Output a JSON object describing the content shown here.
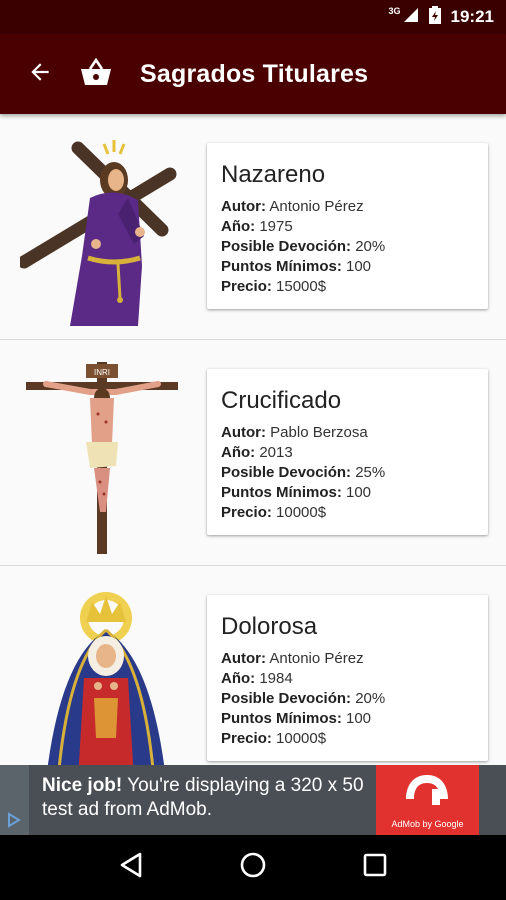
{
  "status_bar": {
    "network": "3G",
    "time": "19:21"
  },
  "app_bar": {
    "title": "Sagrados Titulares"
  },
  "items": [
    {
      "name": "Nazareno",
      "autor_label": "Autor:",
      "autor": "Antonio Pérez",
      "anio_label": "Año:",
      "anio": "1975",
      "devocion_label": "Posible Devoción:",
      "devocion": "20%",
      "puntos_label": "Puntos Mínimos:",
      "puntos": "100",
      "precio_label": "Precio:",
      "precio": "15000$"
    },
    {
      "name": "Crucificado",
      "autor_label": "Autor:",
      "autor": "Pablo Berzosa",
      "anio_label": "Año:",
      "anio": "2013",
      "devocion_label": "Posible Devoción:",
      "devocion": "25%",
      "puntos_label": "Puntos Mínimos:",
      "puntos": "100",
      "precio_label": "Precio:",
      "precio": "10000$"
    },
    {
      "name": "Dolorosa",
      "autor_label": "Autor:",
      "autor": "Antonio Pérez",
      "anio_label": "Año:",
      "anio": "1984",
      "devocion_label": "Posible Devoción:",
      "devocion": "20%",
      "puntos_label": "Puntos Mínimos:",
      "puntos": "100",
      "precio_label": "Precio:",
      "precio": "10000$"
    }
  ],
  "cross_sign": "INRI",
  "ad": {
    "headline": "Nice job!",
    "body": " You're displaying a 320 x 50 test ad from AdMob.",
    "logo_caption": "AdMob by Google"
  },
  "colors": {
    "app_bar": "#4a0000",
    "status_bar": "#3a0000",
    "ad_red": "#e2322f"
  },
  "icons": [
    "arrow-back-icon",
    "basket-icon",
    "nav-back-icon",
    "nav-home-icon",
    "nav-recents-icon",
    "signal-icon",
    "battery-icon",
    "adchoices-icon"
  ]
}
